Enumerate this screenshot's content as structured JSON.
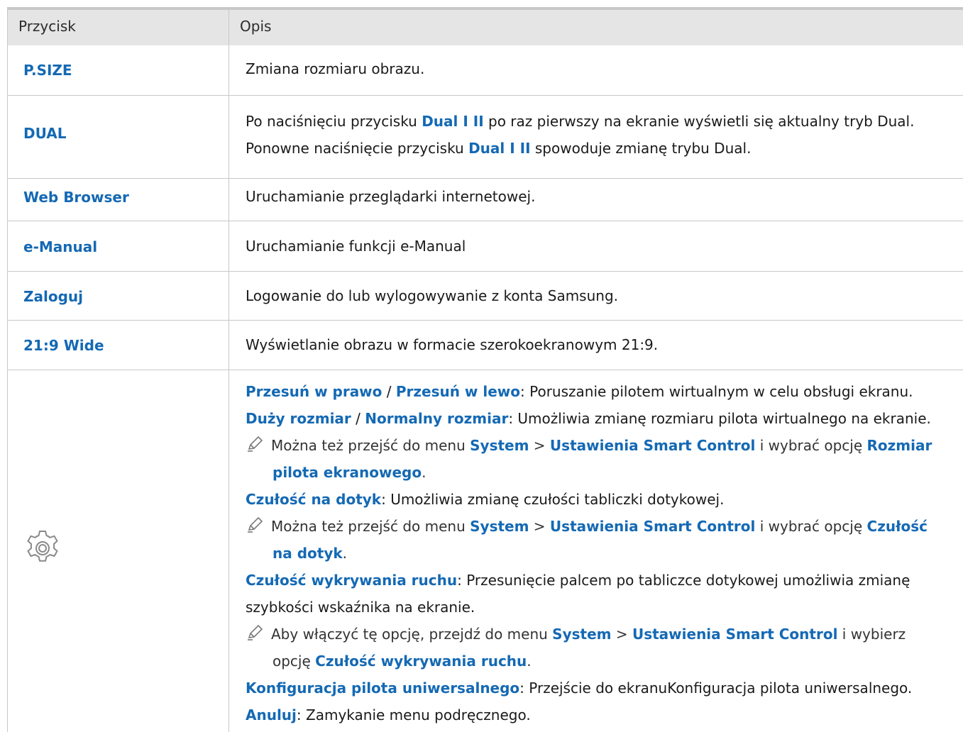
{
  "header": {
    "col1": "Przycisk",
    "col2": "Opis"
  },
  "rows": [
    {
      "button": "P.SIZE",
      "desc": "Zmiana rozmiaru obrazu."
    },
    {
      "button": "DUAL",
      "desc1a": "Po naciśnięciu przycisku ",
      "desc1b": "Dual I II",
      "desc1c": " po raz pierwszy na ekranie wyświetli się aktualny tryb Dual.",
      "desc2a": "Ponowne naciśnięcie przycisku ",
      "desc2b": "Dual I II",
      "desc2c": " spowoduje zmianę trybu Dual."
    },
    {
      "button": "Web Browser",
      "desc": "Uruchamianie przeglądarki internetowej."
    },
    {
      "button": "e-Manual",
      "desc": "Uruchamianie funkcji e-Manual"
    },
    {
      "button": "Zaloguj",
      "desc": "Logowanie do lub wylogowywanie z konta Samsung."
    },
    {
      "button": "21:9 Wide",
      "desc": "Wyświetlanie obrazu w formacie szerokoekranowym 21:9."
    }
  ],
  "settings": {
    "icon": "gear-icon",
    "l1a": "Przesuń w prawo",
    "l1b": " / ",
    "l1c": "Przesuń w lewo",
    "l1d": ": Poruszanie pilotem wirtualnym w celu obsługi ekranu.",
    "l2a": "Duży rozmiar",
    "l2b": " / ",
    "l2c": "Normalny rozmiar",
    "l2d": ": Umożliwia zmianę rozmiaru pilota wirtualnego na ekranie.",
    "n1a": "Można też przejść do menu ",
    "n1b": "System",
    "n1c": " > ",
    "n1d": "Ustawienia Smart Control",
    "n1e": " i wybrać opcję ",
    "n1f": "Rozmiar",
    "n1g": "pilota ekranowego",
    "n1h": ".",
    "l3a": "Czułość na dotyk",
    "l3b": ": Umożliwia zmianę czułości tabliczki dotykowej.",
    "n2a": "Można też przejść do menu ",
    "n2b": "System",
    "n2c": " > ",
    "n2d": "Ustawienia Smart Control",
    "n2e": " i wybrać opcję ",
    "n2f": "Czułość",
    "n2g": "na dotyk",
    "n2h": ".",
    "l4a": "Czułość wykrywania ruchu",
    "l4b": ": Przesunięcie palcem po tabliczce dotykowej umożliwia zmianę",
    "l4c": "szybkości wskaźnika na ekranie.",
    "n3a": "Aby włączyć tę opcję, przejdź do menu ",
    "n3b": "System",
    "n3c": " > ",
    "n3d": "Ustawienia Smart Control",
    "n3e": " i wybierz",
    "n3f": "opcję ",
    "n3g": "Czułość wykrywania ruchu",
    "n3h": ".",
    "l5a": "Konfiguracja pilota uniwersalnego",
    "l5b": ": Przejście do ekranuKonfiguracja pilota uniwersalnego.",
    "l6a": "Anuluj",
    "l6b": ": Zamykanie menu podręcznego."
  }
}
